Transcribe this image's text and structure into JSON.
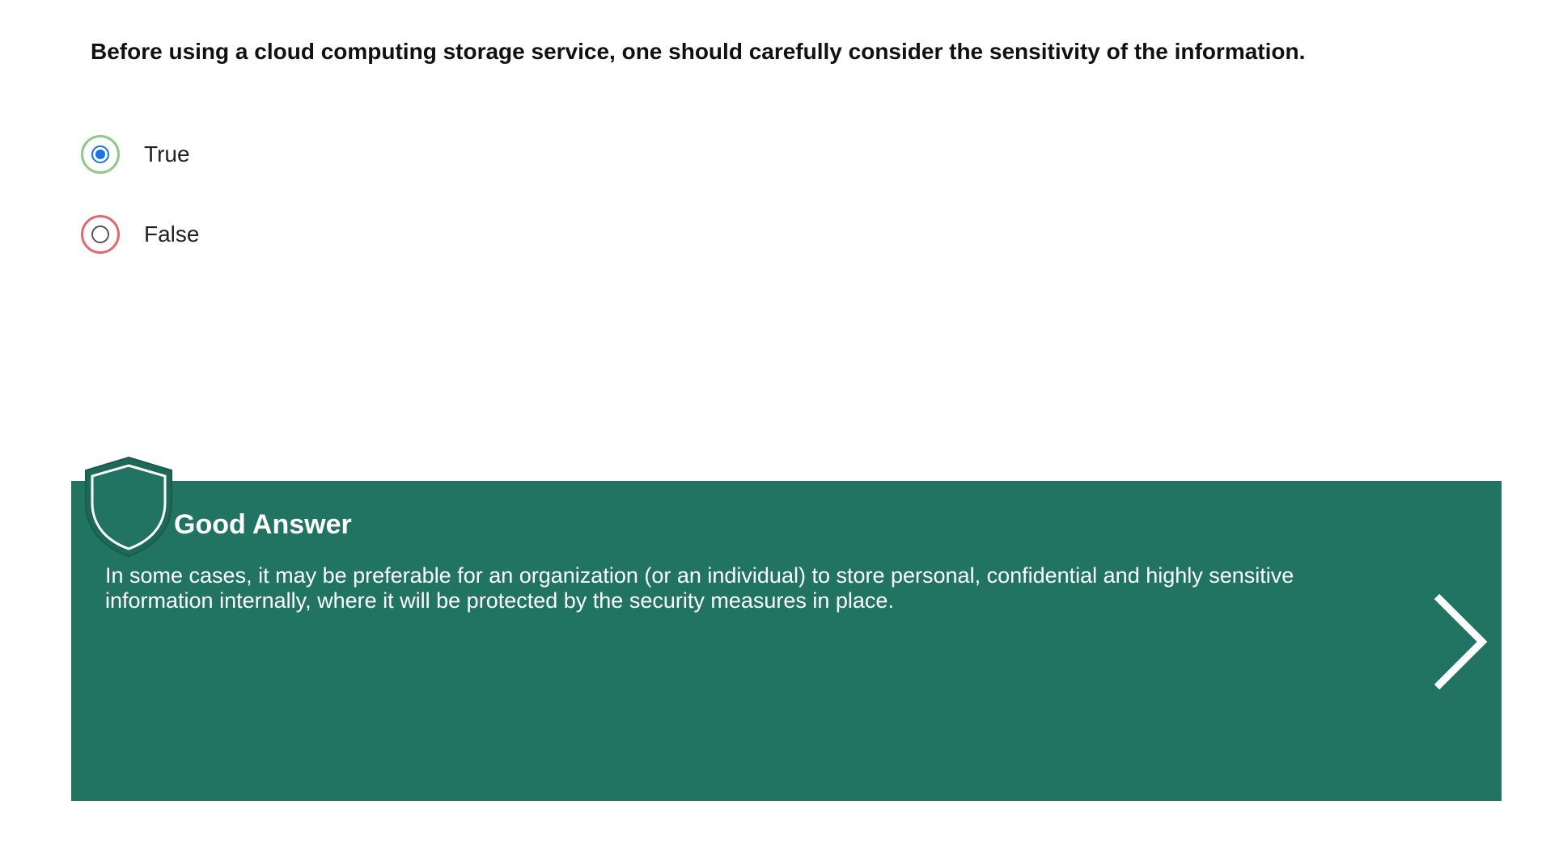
{
  "question": {
    "text": "Before using a cloud computing storage service, one should carefully consider the sensitivity of the information."
  },
  "options": [
    {
      "label": "True",
      "selected": true,
      "status": "correct"
    },
    {
      "label": "False",
      "selected": false,
      "status": "incorrect"
    }
  ],
  "feedback": {
    "title": "Good Answer",
    "text": "In some cases, it may be preferable for an organization (or an individual) to store personal, confidential and highly sensitive information internally, where it will be protected by the security measures in place.",
    "icon": "shield-icon",
    "next_icon": "chevron-right-icon"
  },
  "colors": {
    "feedback_bg": "#217461",
    "correct_ring": "#8fc98a",
    "incorrect_ring": "#e06b6b",
    "radio_selected": "#1a73e8"
  }
}
